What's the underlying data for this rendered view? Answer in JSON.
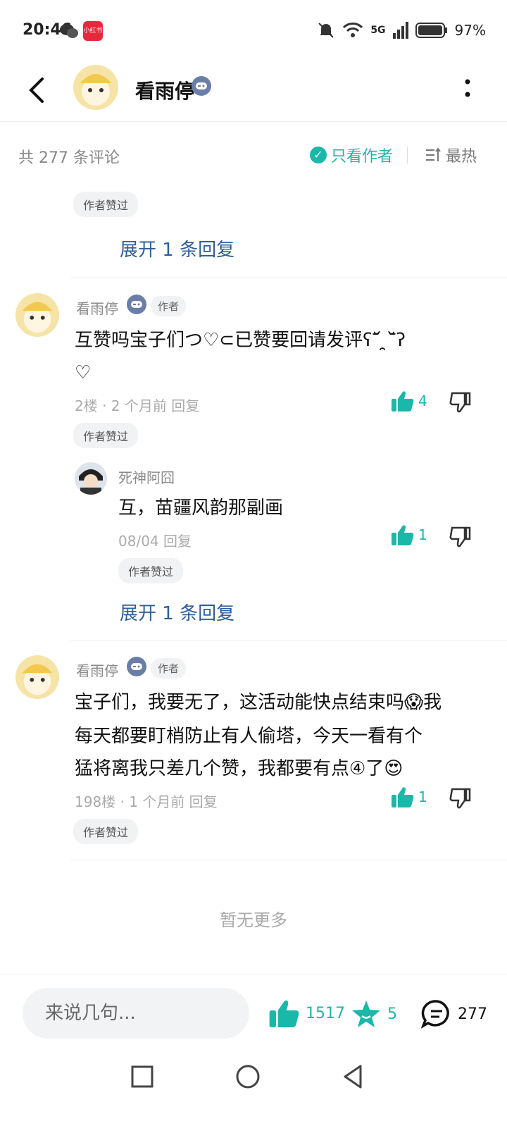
{
  "status": {
    "time": "20:46",
    "app_badge": "小红书",
    "network": "5G",
    "battery": "97%"
  },
  "header": {
    "name": "看雨停"
  },
  "filter": {
    "count": "共 277 条评论",
    "only_author": "只看作者",
    "sort": "最热"
  },
  "top_partial": {
    "liked_by_author": "作者赞过",
    "expand": "展开 1 条回复"
  },
  "comments": [
    {
      "name": "看雨停",
      "author_tag": "作者",
      "text_line1": "互赞吗宝子们つ♡⊂已赞要回请发评ʕ˘᷄ ̯˘᷅ʔ",
      "text_line2": "♡",
      "meta": "2楼 · 2 个月前  回复",
      "likes": "4",
      "liked_by_author": "作者赞过",
      "reply": {
        "name": "死神阿囧",
        "text": "互，苗疆风韵那副画",
        "meta": "08/04  回复",
        "likes": "1",
        "liked_by_author": "作者赞过"
      },
      "expand": "展开 1 条回复"
    },
    {
      "name": "看雨停",
      "author_tag": "作者",
      "text_line1": "宝子们，我要无了，这活动能快点结束吗😱我",
      "text_line2": "每天都要盯梢防止有人偷塔，今天一看有个",
      "text_line3": "猛将离我只差几个赞，我都要有点④了😍",
      "meta": "198楼 · 1 个月前  回复",
      "likes": "1",
      "liked_by_author": "作者赞过"
    }
  ],
  "no_more": "暂无更多",
  "bottom": {
    "placeholder": "来说几句...",
    "likes": "1517",
    "stars": "5",
    "comments": "277"
  },
  "colors": {
    "accent": "#19b8a8",
    "link": "#2e5e99"
  }
}
